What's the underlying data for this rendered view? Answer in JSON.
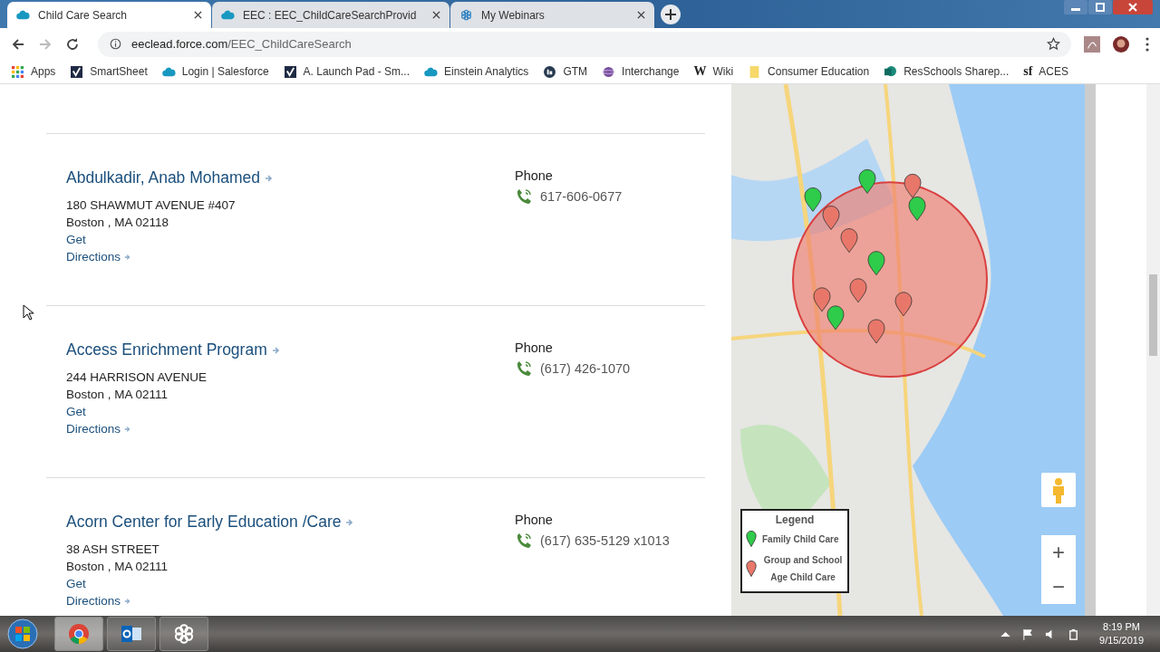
{
  "browser": {
    "tabs": [
      {
        "title": "Child Care Search",
        "selected": true
      },
      {
        "title": "EEC : EEC_ChildCareSearchProvid",
        "selected": false
      },
      {
        "title": "My Webinars",
        "selected": false
      }
    ],
    "url": {
      "host": "eeclead.force.com",
      "path": "/EEC_ChildCareSearch"
    },
    "bookmarks": [
      {
        "label": "Apps"
      },
      {
        "label": "SmartSheet"
      },
      {
        "label": "Login | Salesforce"
      },
      {
        "label": "A. Launch Pad - Sm..."
      },
      {
        "label": "Einstein Analytics"
      },
      {
        "label": "GTM"
      },
      {
        "label": "Interchange"
      },
      {
        "label": "Wiki",
        "glyph": "W"
      },
      {
        "label": "Consumer Education"
      },
      {
        "label": "ResSchools Sharep..."
      },
      {
        "label": "ACES",
        "glyph": "sf"
      }
    ]
  },
  "listings": [
    {
      "name": "Abdulkadir, Anab Mohamed",
      "address": [
        "180 SHAWMUT AVENUE #407",
        "Boston , MA 02118"
      ],
      "link_get": "Get",
      "link_directions": "Directions",
      "phone_label": "Phone",
      "phone": "617-606-0677"
    },
    {
      "name": "Access Enrichment Program",
      "address": [
        "244 HARRISON AVENUE",
        "Boston , MA 02111"
      ],
      "link_get": "Get",
      "link_directions": "Directions",
      "phone_label": "Phone",
      "phone": "(617) 426-1070"
    },
    {
      "name": "Acorn Center for Early Education /Care",
      "address": [
        "38 ASH STREET",
        "Boston , MA 02111"
      ],
      "link_get": "Get",
      "link_directions": "Directions",
      "phone_label": "Phone",
      "phone": "(617) 635-5129 x1013"
    }
  ],
  "map": {
    "legend": {
      "title": "Legend",
      "items": [
        {
          "label": "Family Child Care",
          "color": "#2ecc4a"
        },
        {
          "label": "Group and School Age Child Care",
          "color": "#e8776a"
        }
      ]
    },
    "zoom_in": "+",
    "zoom_out": "−"
  },
  "taskbar": {
    "time": "8:19 PM",
    "date": "9/15/2019"
  }
}
